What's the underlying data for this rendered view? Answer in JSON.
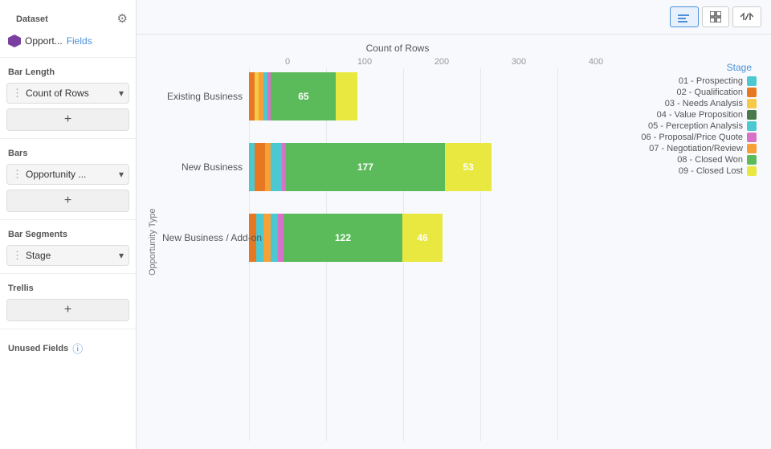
{
  "sidebar": {
    "gear_icon": "⚙",
    "dataset_label": "Dataset",
    "dataset_name": "Opport...",
    "fields_link": "Fields",
    "bar_length_label": "Bar Length",
    "bar_length_field": "Count of Rows",
    "bars_label": "Bars",
    "bars_field": "Opportunity ...",
    "bar_segments_label": "Bar Segments",
    "bar_segments_field": "Stage",
    "trellis_label": "Trellis",
    "unused_label": "Unused Fields",
    "add_icon": "+"
  },
  "toolbar": {
    "btn1_icon": "≡≡",
    "btn2_icon": "⊞",
    "btn3_icon": "∫"
  },
  "chart": {
    "title": "Count of Rows",
    "y_axis_label": "Opportunity Type",
    "x_ticks": [
      "0",
      "100",
      "200",
      "300",
      "400"
    ],
    "bars": [
      {
        "label": "Existing Business",
        "total_width_pct": 37,
        "segments": [
          {
            "color": "#e87722",
            "width_pct": 1.5,
            "label": ""
          },
          {
            "color": "#f7c948",
            "width_pct": 1.2,
            "label": ""
          },
          {
            "color": "#f7a035",
            "width_pct": 1.2,
            "label": ""
          },
          {
            "color": "#4bc8d0",
            "width_pct": 1.2,
            "label": ""
          },
          {
            "color": "#d971c8",
            "width_pct": 1.0,
            "label": ""
          },
          {
            "color": "#5bbb5b",
            "width_pct": 18,
            "label": "65"
          },
          {
            "color": "#e8e840",
            "width_pct": 6,
            "label": ""
          }
        ]
      },
      {
        "label": "New Business",
        "total_width_pct": 90,
        "segments": [
          {
            "color": "#4bc8d0",
            "width_pct": 1.5,
            "label": ""
          },
          {
            "color": "#e87722",
            "width_pct": 3.0,
            "label": ""
          },
          {
            "color": "#f7a035",
            "width_pct": 1.5,
            "label": ""
          },
          {
            "color": "#4bc8d0",
            "width_pct": 3.0,
            "label": ""
          },
          {
            "color": "#d971c8",
            "width_pct": 1.2,
            "label": ""
          },
          {
            "color": "#5bbb5b",
            "width_pct": 44,
            "label": "177"
          },
          {
            "color": "#e8e840",
            "width_pct": 13,
            "label": "53"
          }
        ]
      },
      {
        "label": "New Business / Add-on",
        "total_width_pct": 75,
        "segments": [
          {
            "color": "#e87722",
            "width_pct": 2.0,
            "label": ""
          },
          {
            "color": "#4bc8d0",
            "width_pct": 2.0,
            "label": ""
          },
          {
            "color": "#f7a035",
            "width_pct": 2.0,
            "label": ""
          },
          {
            "color": "#4bc8d0",
            "width_pct": 2.0,
            "label": ""
          },
          {
            "color": "#d971c8",
            "width_pct": 1.5,
            "label": ""
          },
          {
            "color": "#5bbb5b",
            "width_pct": 33,
            "label": "122"
          },
          {
            "color": "#e8e840",
            "width_pct": 11,
            "label": "46"
          }
        ]
      }
    ],
    "legend_title": "Stage",
    "legend_items": [
      {
        "label": "01 - Prospecting",
        "color": "#4bc8d0"
      },
      {
        "label": "02 - Qualification",
        "color": "#e87722"
      },
      {
        "label": "03 - Needs Analysis",
        "color": "#f7c948"
      },
      {
        "label": "04 - Value Proposition",
        "color": "#4a7a4a"
      },
      {
        "label": "05 - Perception Analysis",
        "color": "#4bc8d0"
      },
      {
        "label": "06 - Proposal/Price Quote",
        "color": "#d971c8"
      },
      {
        "label": "07 - Negotiation/Review",
        "color": "#f7a035"
      },
      {
        "label": "08 - Closed Won",
        "color": "#5bbb5b"
      },
      {
        "label": "09 - Closed Lost",
        "color": "#e8e840"
      }
    ]
  }
}
